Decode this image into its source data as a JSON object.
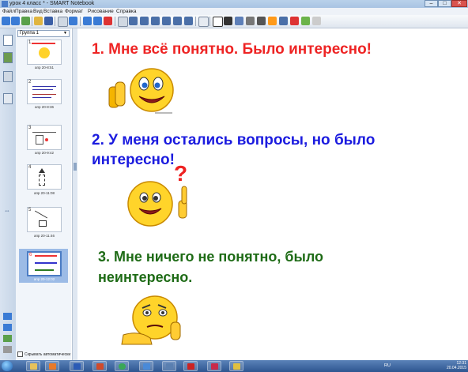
{
  "window": {
    "title": "урок 4 класс * - SMART Notebook",
    "controls": [
      "–",
      "□",
      "✕"
    ]
  },
  "menu": [
    "Файл",
    "Правка",
    "Вид",
    "Вставка",
    "Формат",
    "Рисование",
    "Справка"
  ],
  "page_sorter": {
    "group_label": "Группа 1",
    "thumbnails": [
      {
        "number": "1",
        "label": "апр 20-8:51"
      },
      {
        "number": "2",
        "label": "апр 20-8:36"
      },
      {
        "number": "3",
        "label": "апр 20-9:42"
      },
      {
        "number": "4",
        "label": "апр 20-11:08"
      },
      {
        "number": "5",
        "label": "апр 20-11:46"
      },
      {
        "number": "6",
        "label": "апр 20-12:02"
      }
    ],
    "selected_index": 5,
    "autohide_label": "Скрывать автоматически"
  },
  "canvas": {
    "line1": "1. Мне всё понятно. Было интересно!",
    "line2a": "2. У меня остались вопросы, но было",
    "line2b": "интересно!",
    "question_mark": "?",
    "line3a": "3. Мне ничего не понятно, было",
    "line3b": "неинтересно.",
    "colors": {
      "red": "#ee2424",
      "blue": "#1b1bdf",
      "green": "#1e6b16"
    }
  },
  "taskbar": {
    "language": "RU",
    "time": "12:31",
    "date": "20.04.2015"
  }
}
